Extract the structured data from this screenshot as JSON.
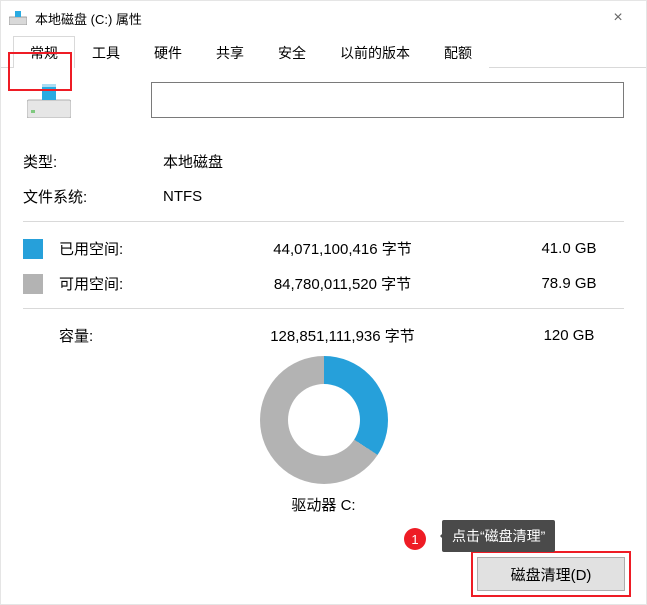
{
  "window": {
    "title": "本地磁盘 (C:) 属性"
  },
  "tabs": [
    "常规",
    "工具",
    "硬件",
    "共享",
    "安全",
    "以前的版本",
    "配额"
  ],
  "active_tab_index": 0,
  "volume_name": "",
  "type_label": "类型:",
  "type_value": "本地磁盘",
  "fs_label": "文件系统:",
  "fs_value": "NTFS",
  "used": {
    "label": "已用空间:",
    "bytes": "44,071,100,416 字节",
    "human": "41.0 GB"
  },
  "free": {
    "label": "可用空间:",
    "bytes": "84,780,011,520 字节",
    "human": "78.9 GB"
  },
  "capacity": {
    "label": "容量:",
    "bytes": "128,851,111,936 字节",
    "human": "120 GB"
  },
  "drive_label": "驱动器 C:",
  "cleanup_button": "磁盘清理(D)",
  "annotation": {
    "number": "1",
    "tooltip": "点击“磁盘清理”"
  },
  "colors": {
    "used": "#26a0da",
    "free": "#b3b3b3",
    "highlight": "#ee1c25"
  },
  "chart_data": {
    "type": "pie",
    "title": "驱动器 C:",
    "series": [
      {
        "name": "已用空间",
        "value": 44071100416,
        "human": "41.0 GB",
        "color": "#26a0da"
      },
      {
        "name": "可用空间",
        "value": 84780011520,
        "human": "78.9 GB",
        "color": "#b3b3b3"
      }
    ],
    "total": 128851111936,
    "total_human": "120 GB"
  }
}
